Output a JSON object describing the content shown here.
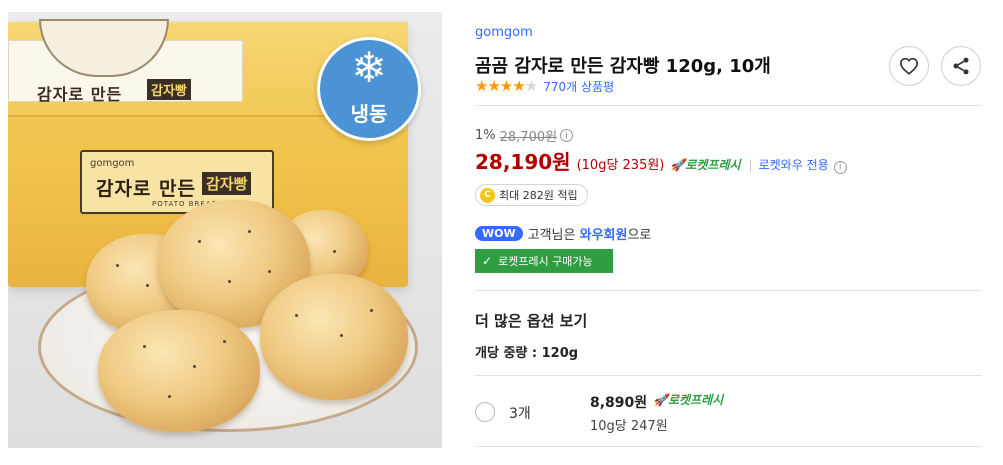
{
  "product_image": {
    "freeze_badge": "냉동",
    "box_sticker_text": "감자로 만든",
    "box_sticker_tag": "감자빵",
    "box_brand": "gomgom",
    "box_label_text": "감자로 만든",
    "box_label_tag": "감자빵",
    "box_label_sub": "POTATO BREAD"
  },
  "product": {
    "brand": "gomgom",
    "title": "곰곰 감자로 만든 감자빵 120g, 10개",
    "rating_stars": 4,
    "rating_max": 5,
    "review_count": "770개 상품평"
  },
  "pricing": {
    "discount_rate": "1%",
    "original_price": "28,700원",
    "sale_price": "28,190원",
    "unit_price": "(10g당 235원)",
    "rocket_badge": "로켓프레시",
    "wow_only": "로켓와우 전용",
    "cash_back": "최대 282원 적립"
  },
  "membership": {
    "wow_badge": "WOW",
    "text_prefix": "고객님은",
    "member_name": "와우회원",
    "text_suffix": "으로",
    "rocket_buy_label": "로켓프레시 구매가능"
  },
  "options": {
    "section_title": "더 많은 옵션 보기",
    "spec_label": "개당 중량 : 120g",
    "items": [
      {
        "qty": "3개",
        "price": "8,890원",
        "rocket": "로켓프레시",
        "unit_price": "10g당 247원"
      }
    ]
  },
  "colors": {
    "accent_blue": "#346aff",
    "price_red": "#ae0000",
    "rocket_green": "#2f9d41",
    "star_orange": "#ff9600"
  }
}
